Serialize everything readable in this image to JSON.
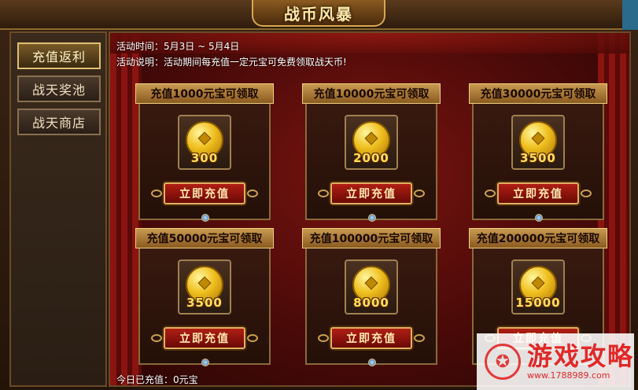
{
  "header": {
    "title": "战币风暴"
  },
  "sidebar": {
    "items": [
      {
        "label": "充值返利",
        "active": true
      },
      {
        "label": "战天奖池",
        "active": false
      },
      {
        "label": "战天商店",
        "active": false
      }
    ]
  },
  "activity": {
    "time": "活动时间：5月3日 ~ 5月4日",
    "description": "活动说明：活动期间每充值一定元宝可免费领取战天币!"
  },
  "cards": [
    {
      "title": "充值1000元宝可领取",
      "amount": "300",
      "button": "立即充值"
    },
    {
      "title": "充值10000元宝可领取",
      "amount": "2000",
      "button": "立即充值"
    },
    {
      "title": "充值30000元宝可领取",
      "amount": "3500",
      "button": "立即充值"
    },
    {
      "title": "充值50000元宝可领取",
      "amount": "3500",
      "button": "立即充值"
    },
    {
      "title": "充值100000元宝可领取",
      "amount": "8000",
      "button": "立即充值"
    },
    {
      "title": "充值200000元宝可领取",
      "amount": "15000",
      "button": "立即充值"
    }
  ],
  "footer": {
    "today_recharge": "今日已充值：0元宝"
  },
  "watermark": {
    "title": "游戏攻略",
    "url": "www.1788989.com"
  },
  "colors": {
    "accent_gold": "#e0b060",
    "button_red": "#b01e14",
    "coin_gold": "#f0c020"
  }
}
